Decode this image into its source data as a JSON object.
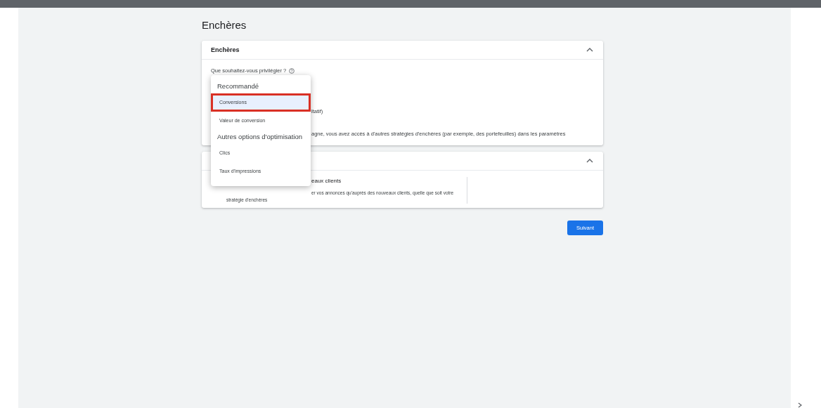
{
  "page_title": "Enchères",
  "bidding_card": {
    "title": "Enchères",
    "expanded": true,
    "question": "Que souhaitez-vous privilégier ?",
    "line_1": "ltatif)",
    "line_2": "agne, vous avez accès à d'autres stratégies d'enchères (par exemple, des portefeuilles) dans les paramètres"
  },
  "customer_card": {
    "expanded": true,
    "heading": "eaux clients",
    "description": "er vos annonces qu'auprès des nouveaux clients, quelle que soit votre",
    "description_2": "stratégie d'enchères"
  },
  "dropdown_menu": {
    "items": [
      {
        "kind": "header",
        "label": "Recommandé"
      },
      {
        "kind": "option",
        "label": "Conversions",
        "selected": true
      },
      {
        "kind": "option",
        "label": "Valeur de conversion",
        "selected": false
      },
      {
        "kind": "header",
        "label": "Autres options d'optimisation"
      },
      {
        "kind": "option",
        "label": "Clics",
        "selected": false
      },
      {
        "kind": "option",
        "label": "Taux d'impressions",
        "selected": false
      }
    ]
  },
  "next_button": "Suivant"
}
